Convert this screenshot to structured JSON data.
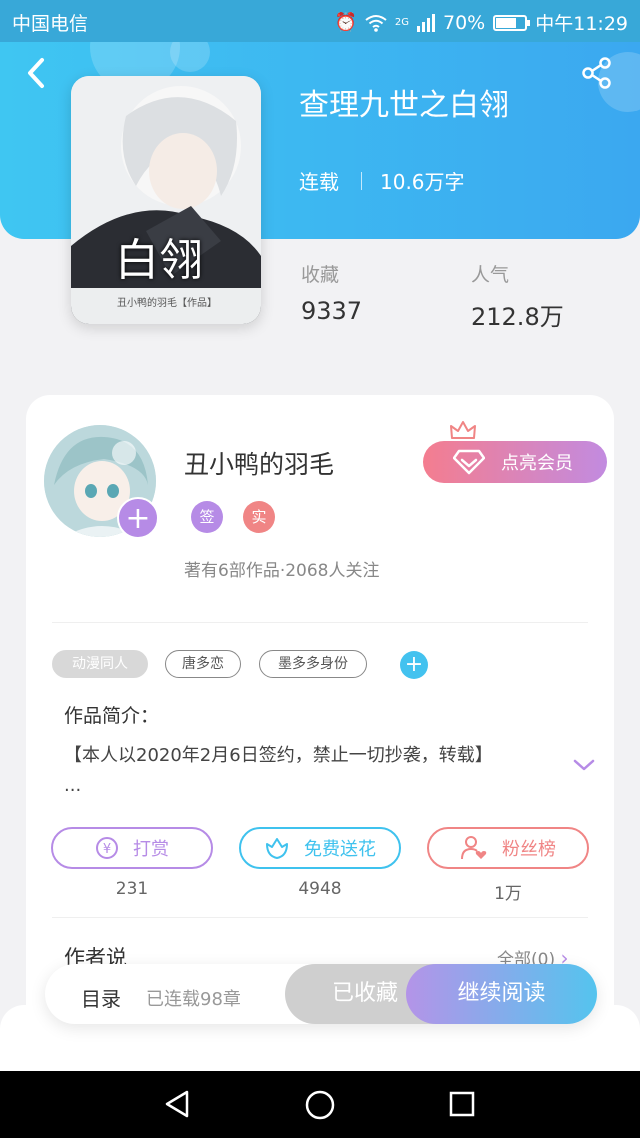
{
  "statusbar": {
    "carrier": "中国电信",
    "network": "2G",
    "battery": "70%",
    "time": "中午11:29",
    "battery_level": 0.7
  },
  "book": {
    "title": "查理九世之白翎",
    "serial_status": "连载",
    "word_count": "10.6万字",
    "cover_title": "白翎",
    "cover_caption": "丑小鸭的羽毛【作品】",
    "stats": [
      {
        "label": "收藏",
        "value": "9337"
      },
      {
        "label": "人气",
        "value": "212.8万"
      }
    ]
  },
  "author": {
    "name": "丑小鸭的羽毛",
    "badges": [
      "签",
      "实"
    ],
    "meta": "著有6部作品·2068人关注",
    "vip_label": "点亮会员"
  },
  "tags": [
    "动漫同人",
    "唐多恋",
    "墨多多身份"
  ],
  "intro": {
    "label": "作品简介：",
    "text": "【本人以2020年2月6日签约，禁止一切抄袭，转载】",
    "ellipsis": "..."
  },
  "actions": [
    {
      "label": "打赏",
      "count": "231",
      "color": "#b68be6"
    },
    {
      "label": "免费送花",
      "count": "4948",
      "color": "#3fc2ee"
    },
    {
      "label": "粉丝榜",
      "count": "1万",
      "color": "#f08585"
    }
  ],
  "author_says": {
    "label": "作者说",
    "all_link": "全部(0)"
  },
  "bottom": {
    "toc_label": "目录",
    "toc_status": "已连载98章",
    "collected_label": "已收藏",
    "read_label": "继续阅读"
  },
  "colors": {
    "header_start": "#3fc6f2",
    "header_end": "#3ba8f0",
    "accent_purple": "#b68be6",
    "accent_blue": "#3fc2ee",
    "accent_red": "#f08585"
  }
}
